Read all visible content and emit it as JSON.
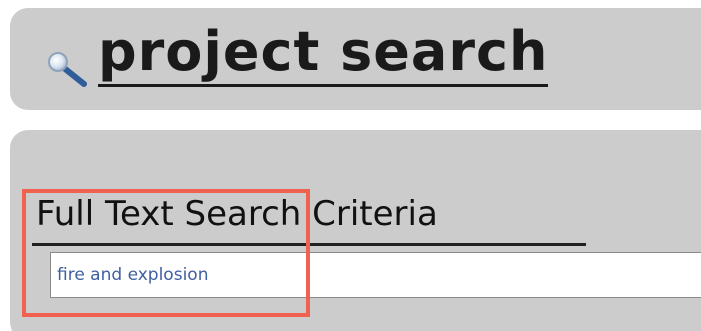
{
  "header": {
    "title": "project search",
    "icon": "search-icon"
  },
  "search": {
    "section_title": "Full Text Search Criteria",
    "query_value": "fire and explosion"
  },
  "highlight": {
    "color": "#f0624f"
  },
  "colors": {
    "panel": "#cccccc",
    "input_text": "#3f5fa0"
  }
}
